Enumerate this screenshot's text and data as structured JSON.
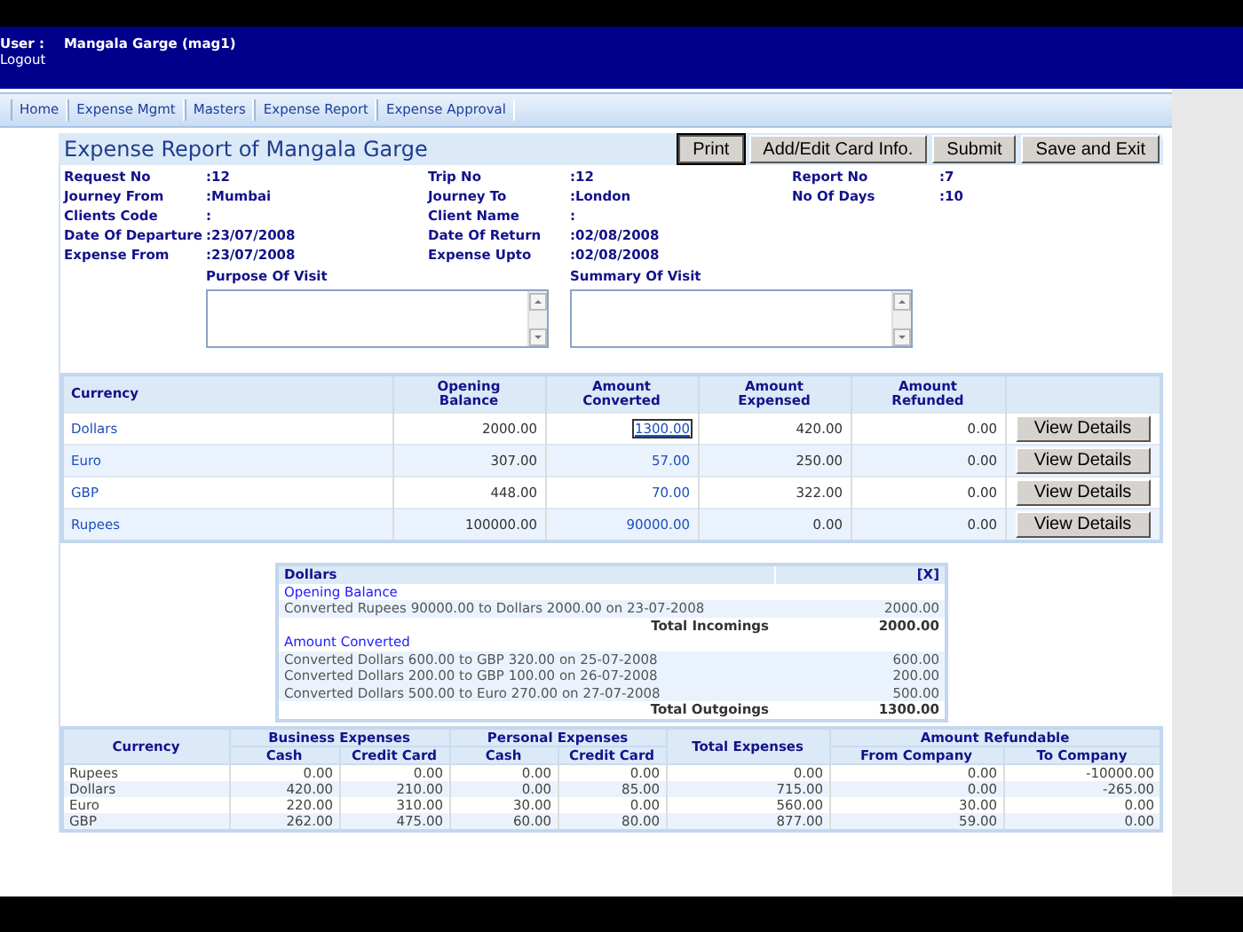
{
  "header": {
    "user_label": "User :",
    "user_name": "Mangala Garge (mag1)",
    "logout": "Logout"
  },
  "nav": [
    "Home",
    "Expense Mgmt",
    "Masters",
    "Expense Report",
    "Expense Approval"
  ],
  "title": "Expense Report of Mangala Garge",
  "buttons": [
    "Print",
    "Add/Edit Card Info.",
    "Submit",
    "Save and Exit"
  ],
  "field_rows": [
    [
      {
        "label": "Request No",
        "value": ":12"
      },
      {
        "label": "Trip No",
        "value": ":12"
      },
      {
        "label": "Report No",
        "value": ":7"
      }
    ],
    [
      {
        "label": "Journey From",
        "value": ":Mumbai"
      },
      {
        "label": "Journey To",
        "value": ":London"
      },
      {
        "label": "No Of Days",
        "value": ":10"
      }
    ],
    [
      {
        "label": "Clients Code",
        "value": ":"
      },
      {
        "label": "Client Name",
        "value": ":"
      }
    ],
    [
      {
        "label": "Date Of Departure",
        "value": ":23/07/2008"
      },
      {
        "label": "Date Of Return",
        "value": ":02/08/2008"
      }
    ],
    [
      {
        "label": "Expense From",
        "value": ":23/07/2008"
      },
      {
        "label": "Expense Upto",
        "value": ":02/08/2008"
      }
    ]
  ],
  "text_areas": [
    {
      "label": "Purpose Of Visit"
    },
    {
      "label": "Summary Of Visit"
    }
  ],
  "balance_table": {
    "columns": [
      "Currency",
      "Opening Balance",
      "Amount Converted",
      "Amount Expensed",
      "Amount Refunded"
    ],
    "rows": [
      {
        "currency": "Dollars",
        "opening": "2000.00",
        "converted": "1300.00",
        "expensed": "420.00",
        "refunded": "0.00",
        "action": "View Details",
        "focused": true
      },
      {
        "currency": "Euro",
        "opening": "307.00",
        "converted": "57.00",
        "expensed": "250.00",
        "refunded": "0.00",
        "action": "View Details",
        "focused": false
      },
      {
        "currency": "GBP",
        "opening": "448.00",
        "converted": "70.00",
        "expensed": "322.00",
        "refunded": "0.00",
        "action": "View Details",
        "focused": false
      },
      {
        "currency": "Rupees",
        "opening": "100000.00",
        "converted": "90000.00",
        "expensed": "0.00",
        "refunded": "0.00",
        "action": "View Details",
        "focused": false
      }
    ]
  },
  "detail": {
    "title": "Dollars",
    "close": "[X]",
    "sections": [
      {
        "heading": "Opening Balance",
        "lines": [
          {
            "text": "Converted Rupees 90000.00 to Dollars 2000.00 on 23-07-2008",
            "amount": "2000.00"
          }
        ],
        "total_label": "Total Incomings",
        "total": "2000.00"
      },
      {
        "heading": "Amount Converted",
        "lines": [
          {
            "text": "Converted Dollars 600.00 to GBP 320.00 on 25-07-2008",
            "amount": "600.00"
          },
          {
            "text": "Converted Dollars 200.00 to GBP 100.00 on 26-07-2008",
            "amount": "200.00"
          },
          {
            "text": "Converted Dollars 500.00 to Euro 270.00 on 27-07-2008",
            "amount": "500.00"
          }
        ],
        "total_label": "Total Outgoings",
        "total": "1300.00"
      }
    ]
  },
  "summary_table": {
    "header": [
      {
        "label": "Currency"
      },
      {
        "label": "Business Expenses",
        "sub": [
          "Cash",
          "Credit Card"
        ]
      },
      {
        "label": "Personal Expenses",
        "sub": [
          "Cash",
          "Credit Card"
        ]
      },
      {
        "label": "Total Expenses"
      },
      {
        "label": "Amount Refundable",
        "sub": [
          "From Company",
          "To Company"
        ]
      }
    ],
    "rows": [
      {
        "currency": "Rupees",
        "cells": [
          "0.00",
          "0.00",
          "0.00",
          "0.00",
          "0.00",
          "0.00",
          "-10000.00"
        ]
      },
      {
        "currency": "Dollars",
        "cells": [
          "420.00",
          "210.00",
          "0.00",
          "85.00",
          "715.00",
          "0.00",
          "-265.00"
        ]
      },
      {
        "currency": "Euro",
        "cells": [
          "220.00",
          "310.00",
          "30.00",
          "0.00",
          "560.00",
          "30.00",
          "0.00"
        ]
      },
      {
        "currency": "GBP",
        "cells": [
          "262.00",
          "475.00",
          "60.00",
          "80.00",
          "877.00",
          "59.00",
          "0.00"
        ]
      }
    ]
  }
}
